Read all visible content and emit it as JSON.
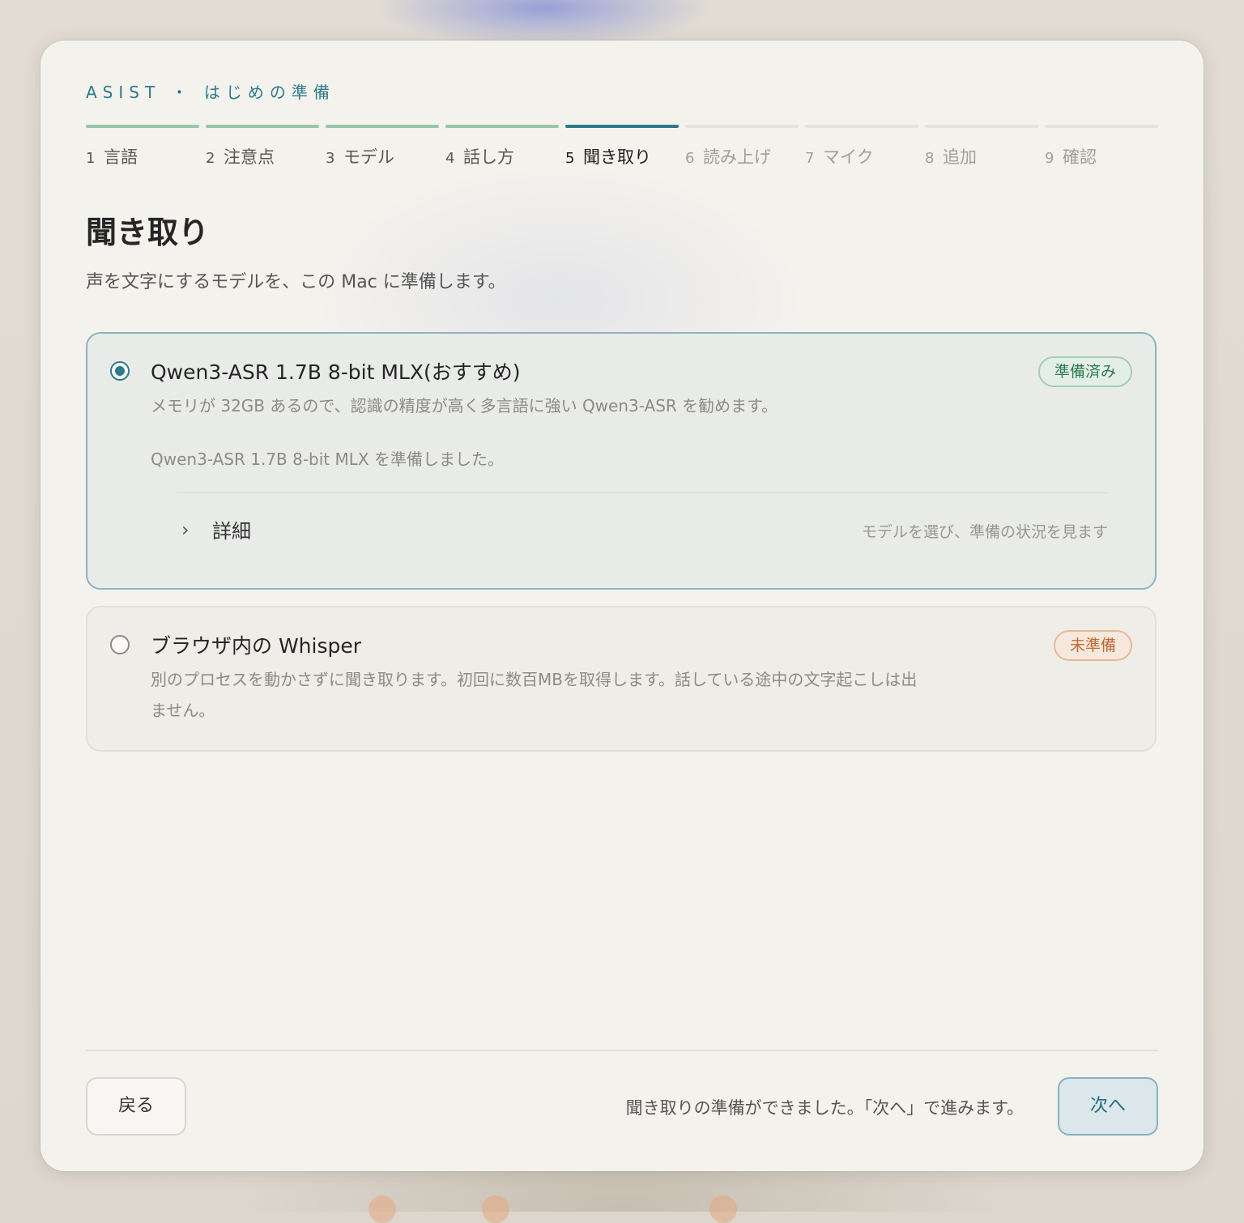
{
  "header": {
    "eyebrow": "ASIST ・ はじめの準備"
  },
  "steps": [
    {
      "num": "1",
      "label": "言語",
      "state": "done"
    },
    {
      "num": "2",
      "label": "注意点",
      "state": "done"
    },
    {
      "num": "3",
      "label": "モデル",
      "state": "done"
    },
    {
      "num": "4",
      "label": "話し方",
      "state": "done"
    },
    {
      "num": "5",
      "label": "聞き取り",
      "state": "current"
    },
    {
      "num": "6",
      "label": "読み上げ",
      "state": "todo"
    },
    {
      "num": "7",
      "label": "マイク",
      "state": "todo"
    },
    {
      "num": "8",
      "label": "追加",
      "state": "todo"
    },
    {
      "num": "9",
      "label": "確認",
      "state": "todo"
    }
  ],
  "page": {
    "title": "聞き取り",
    "subtitle": "声を文字にするモデルを、この Mac に準備します。"
  },
  "options": {
    "qwen": {
      "title": "Qwen3-ASR 1.7B 8-bit MLX(おすすめ)",
      "badge": "準備済み",
      "description": "メモリが 32GB あるので、認識の精度が高く多言語に強い Qwen3-ASR を勧めます。",
      "status": "Qwen3-ASR 1.7B 8-bit MLX を準備しました。",
      "details_label": "詳細",
      "details_hint": "モデルを選び、準備の状況を見ます",
      "selected": true
    },
    "whisper": {
      "title": "ブラウザ内の Whisper",
      "badge": "未準備",
      "description_line1": "別のプロセスを動かさずに聞き取ります。初回に数百MBを取得します。話している途中の文字起こしは出",
      "description_line2": "ません。",
      "selected": false
    }
  },
  "footer": {
    "back_label": "戻る",
    "status": "聞き取りの準備ができました。「次へ」で進みます。",
    "next_label": "次へ"
  },
  "colors": {
    "accent": "#2d7a8c",
    "done": "#9cc4a8",
    "ready_badge": "#2f7a52",
    "not_ready_badge": "#c06a32"
  }
}
